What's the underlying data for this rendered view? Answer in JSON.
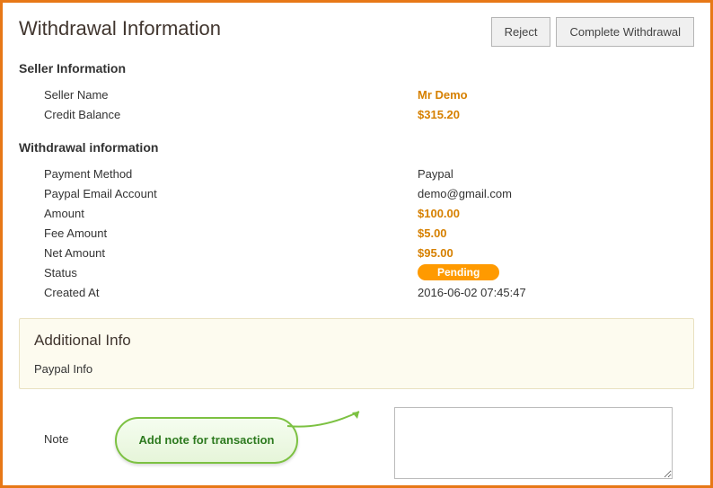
{
  "header": {
    "title": "Withdrawal Information",
    "reject_label": "Reject",
    "complete_label": "Complete Withdrawal"
  },
  "seller_section": {
    "heading": "Seller Information",
    "name_label": "Seller Name",
    "name_value": "Mr Demo",
    "balance_label": "Credit Balance",
    "balance_value": "$315.20"
  },
  "withdrawal_section": {
    "heading": "Withdrawal information",
    "method_label": "Payment Method",
    "method_value": "Paypal",
    "email_label": "Paypal Email Account",
    "email_value": "demo@gmail.com",
    "amount_label": "Amount",
    "amount_value": "$100.00",
    "fee_label": "Fee Amount",
    "fee_value": "$5.00",
    "net_label": "Net Amount",
    "net_value": "$95.00",
    "status_label": "Status",
    "status_value": "Pending",
    "created_label": "Created At",
    "created_value": "2016-06-02 07:45:47"
  },
  "additional": {
    "title": "Additional Info",
    "paypal_info": "Paypal Info"
  },
  "note": {
    "label": "Note",
    "value": ""
  },
  "callout": {
    "text": "Add note for transaction"
  },
  "colors": {
    "accent": "#e77817",
    "money": "#d68000",
    "pill": "#ff9a00",
    "callout_border": "#7cc142"
  }
}
